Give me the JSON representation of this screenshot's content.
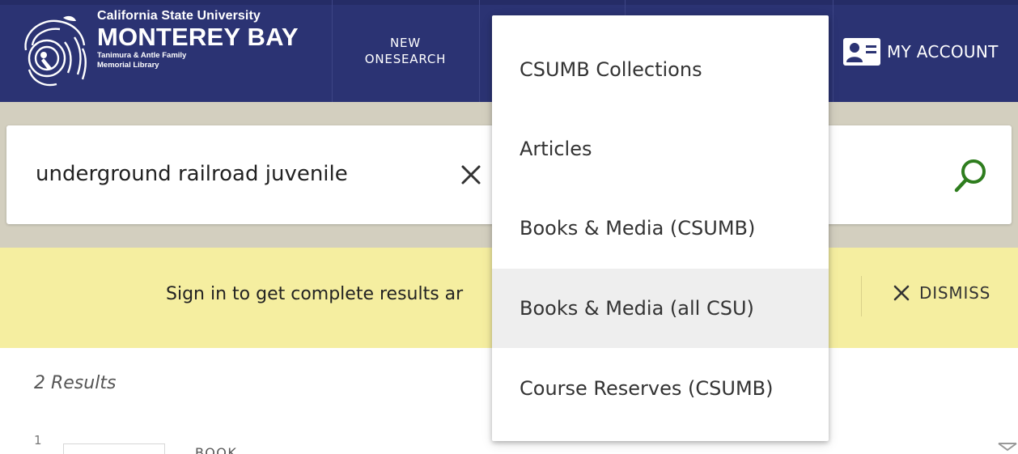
{
  "header": {
    "logo": {
      "line1": "California State University",
      "line2": "MONTEREY BAY",
      "line3": "Tanimura & Antle Family",
      "line4": "Memorial Library"
    },
    "nav": {
      "new_onesearch_line1": "NEW",
      "new_onesearch_line2": "ONESEARCH"
    },
    "account_label": "MY ACCOUNT",
    "colors": {
      "background": "#2b3373",
      "text": "#ffffff"
    }
  },
  "search": {
    "value": "underground railroad juvenile",
    "placeholder": "",
    "clear_icon": "close-icon",
    "go_icon": "search-icon",
    "accent_color": "#2e7d1e"
  },
  "scope_dropdown": {
    "options": [
      "CSUMB Collections",
      "Articles",
      "Books & Media (CSUMB)",
      "Books & Media (all CSU)",
      "Course Reserves (CSUMB)"
    ],
    "highlighted": "Books & Media (all CSU)"
  },
  "notice": {
    "text": "Sign in to get complete results ar",
    "dismiss_label": "DISMISS",
    "background": "#f5eea0"
  },
  "results": {
    "count_text": "2 Results",
    "items": [
      {
        "index": "1",
        "type": "BOOK"
      }
    ]
  }
}
